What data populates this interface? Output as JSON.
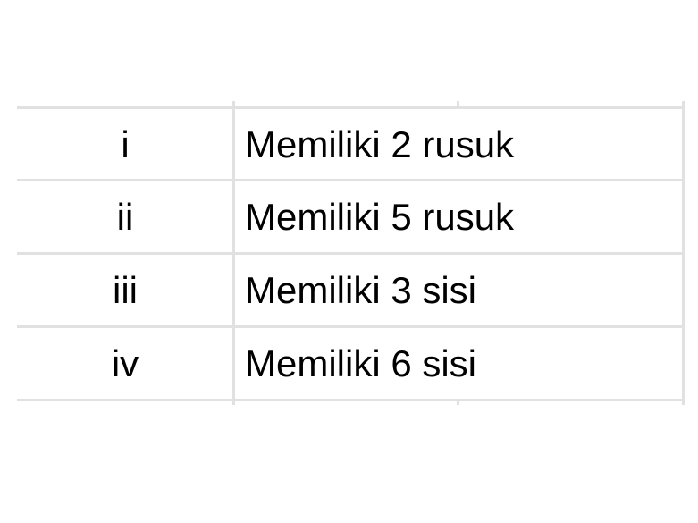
{
  "table": {
    "rows": [
      {
        "label": "i",
        "text": "Memiliki 2 rusuk"
      },
      {
        "label": "ii",
        "text": "Memiliki 5 rusuk"
      },
      {
        "label": "iii",
        "text": "Memiliki 3 sisi"
      },
      {
        "label": "iv",
        "text": "Memiliki 6 sisi"
      }
    ]
  }
}
